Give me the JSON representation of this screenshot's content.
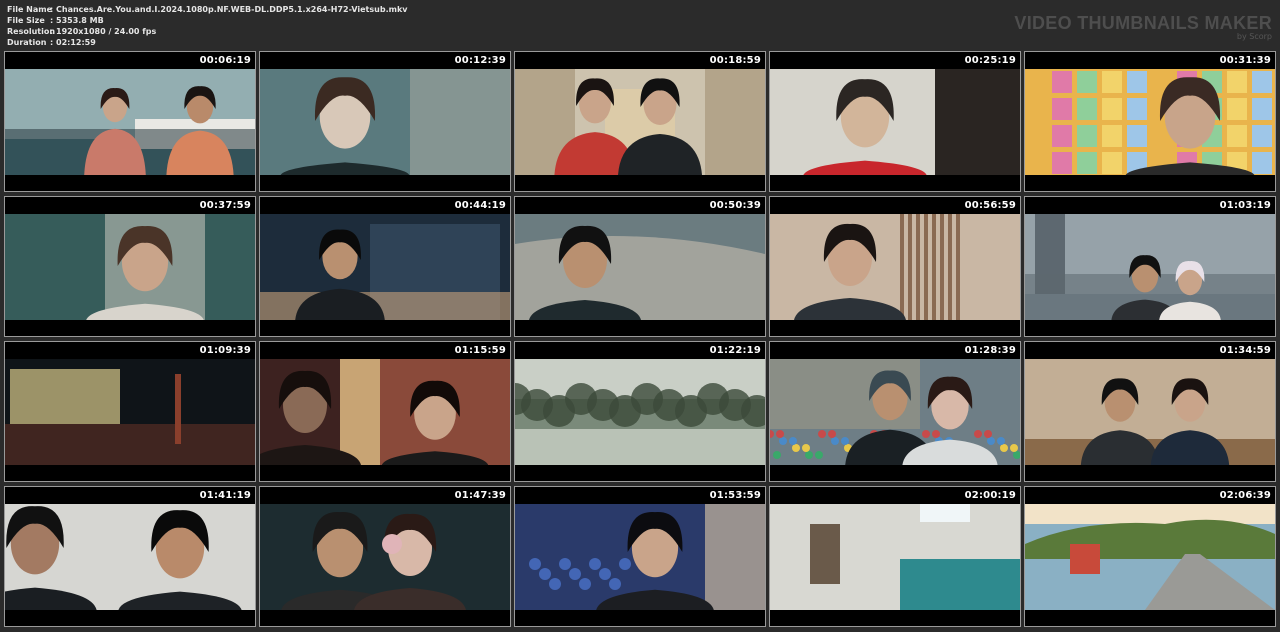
{
  "info": {
    "rows": [
      {
        "label": "File Name",
        "value": "Chances.Are.You.and.I.2024.1080p.NF.WEB-DL.DDP5.1.x264-H72-Vietsub.mkv"
      },
      {
        "label": "File Size",
        "value": "5353.8 MB"
      },
      {
        "label": "Resolution",
        "value": "1920x1080 / 24.00 fps"
      },
      {
        "label": "Duration",
        "value": "02:12:59"
      }
    ],
    "separator": ":"
  },
  "brand": {
    "title": "VIDEO THUMBNAILS MAKER",
    "subtitle": "by Scorp"
  },
  "thumbnails": [
    {
      "time": "00:06:19",
      "scene": "hospital-lobby",
      "palette": [
        "#3f6f78",
        "#d9e2e0",
        "#c97a6a",
        "#2a3b3f"
      ]
    },
    {
      "time": "00:12:39",
      "scene": "girl-closeup",
      "palette": [
        "#5a7a7e",
        "#d8c8b8",
        "#3b2a22",
        "#1d2a2c"
      ]
    },
    {
      "time": "00:18:59",
      "scene": "hallway-two-boys",
      "palette": [
        "#b3a48a",
        "#c23a33",
        "#1f2326",
        "#e8e2d2"
      ]
    },
    {
      "time": "00:25:19",
      "scene": "boy-red-jacket",
      "palette": [
        "#d6d4cc",
        "#c8262c",
        "#2b2623",
        "#f0efe8"
      ]
    },
    {
      "time": "00:31:39",
      "scene": "sticky-note-wall",
      "palette": [
        "#e9b44c",
        "#e07aa8",
        "#8fcf9a",
        "#3a2a24"
      ]
    },
    {
      "time": "00:37:59",
      "scene": "girl-hospital",
      "palette": [
        "#365c5a",
        "#d9d4ca",
        "#4a3428",
        "#1c2a28"
      ]
    },
    {
      "time": "00:44:19",
      "scene": "night-kitchen",
      "palette": [
        "#1d2c3b",
        "#3c536b",
        "#c8a27a",
        "#0e141a"
      ]
    },
    {
      "time": "00:50:39",
      "scene": "seaside-rock",
      "palette": [
        "#6b7c80",
        "#b9b4a8",
        "#1f2a2e",
        "#55676b"
      ]
    },
    {
      "time": "00:56:59",
      "scene": "boy-porch",
      "palette": [
        "#c9b7a4",
        "#2c3238",
        "#8a6a52",
        "#e6dcd0"
      ]
    },
    {
      "time": "01:03:19",
      "scene": "city-plaza",
      "palette": [
        "#7b8a93",
        "#a9b3b8",
        "#2c2f33",
        "#5d6870"
      ]
    },
    {
      "time": "01:09:39",
      "scene": "night-street-store",
      "palette": [
        "#0f1418",
        "#3c4a4e",
        "#d9c98a",
        "#8a3f2c"
      ]
    },
    {
      "time": "01:15:59",
      "scene": "boy-lying-head",
      "palette": [
        "#3d2220",
        "#8a4a3a",
        "#c9c4bc",
        "#1c1412"
      ]
    },
    {
      "time": "01:22:19",
      "scene": "park-trees",
      "palette": [
        "#7a8a7a",
        "#c9cfc6",
        "#3c4a3a",
        "#a9b3a5"
      ]
    },
    {
      "time": "01:28:39",
      "scene": "love-locks",
      "palette": [
        "#6e7e86",
        "#d9dcdc",
        "#b84a4a",
        "#2b3438"
      ]
    },
    {
      "time": "01:34:59",
      "scene": "restaurant-table",
      "palette": [
        "#8a6a4a",
        "#e8dcc8",
        "#2a2622",
        "#c9a276"
      ]
    },
    {
      "time": "01:41:19",
      "scene": "two-boys-closeup",
      "palette": [
        "#d6d6d2",
        "#1e2226",
        "#a37a62",
        "#5a5e62"
      ]
    },
    {
      "time": "01:47:39",
      "scene": "couple-earmuffs",
      "palette": [
        "#1d2c30",
        "#c8a090",
        "#3a2d2a",
        "#e0b4b8"
      ]
    },
    {
      "time": "01:53:59",
      "scene": "boy-blue-lights",
      "palette": [
        "#2a3a6a",
        "#4a72c8",
        "#c9b8a0",
        "#1a1c22"
      ]
    },
    {
      "time": "02:00:19",
      "scene": "clinic-lobby",
      "palette": [
        "#d8d8d2",
        "#2e8a8e",
        "#6a5a4a",
        "#f0efea"
      ]
    },
    {
      "time": "02:06:39",
      "scene": "pier-sunset",
      "palette": [
        "#8ab0c4",
        "#c9a46a",
        "#5a7a3a",
        "#3d4a58"
      ]
    }
  ]
}
